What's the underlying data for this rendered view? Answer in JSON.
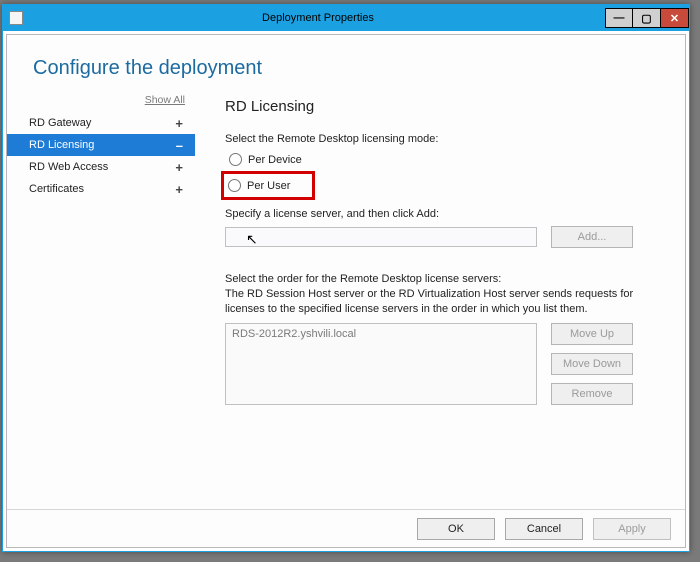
{
  "window": {
    "title": "Deployment Properties"
  },
  "heading": "Configure the deployment",
  "sidebar": {
    "show_all": "Show All",
    "items": [
      {
        "label": "RD Gateway",
        "expander": "+",
        "selected": false
      },
      {
        "label": "RD Licensing",
        "expander": "–",
        "selected": true
      },
      {
        "label": "RD Web Access",
        "expander": "+",
        "selected": false
      },
      {
        "label": "Certificates",
        "expander": "+",
        "selected": false
      }
    ]
  },
  "panel": {
    "title": "RD Licensing",
    "mode_label": "Select the Remote Desktop licensing mode:",
    "radio_per_device": "Per Device",
    "radio_per_user": "Per User",
    "specify_label": "Specify a license server, and then click Add:",
    "add_btn": "Add...",
    "order_label": "Select the order for the Remote Desktop license servers:",
    "order_help": "The RD Session Host server or the RD Virtualization Host server sends requests for licenses to the specified license servers in the order in which you list them.",
    "list_value": "RDS-2012R2.yshvili.local",
    "move_up": "Move Up",
    "move_down": "Move Down",
    "remove": "Remove"
  },
  "footer": {
    "ok": "OK",
    "cancel": "Cancel",
    "apply": "Apply"
  }
}
